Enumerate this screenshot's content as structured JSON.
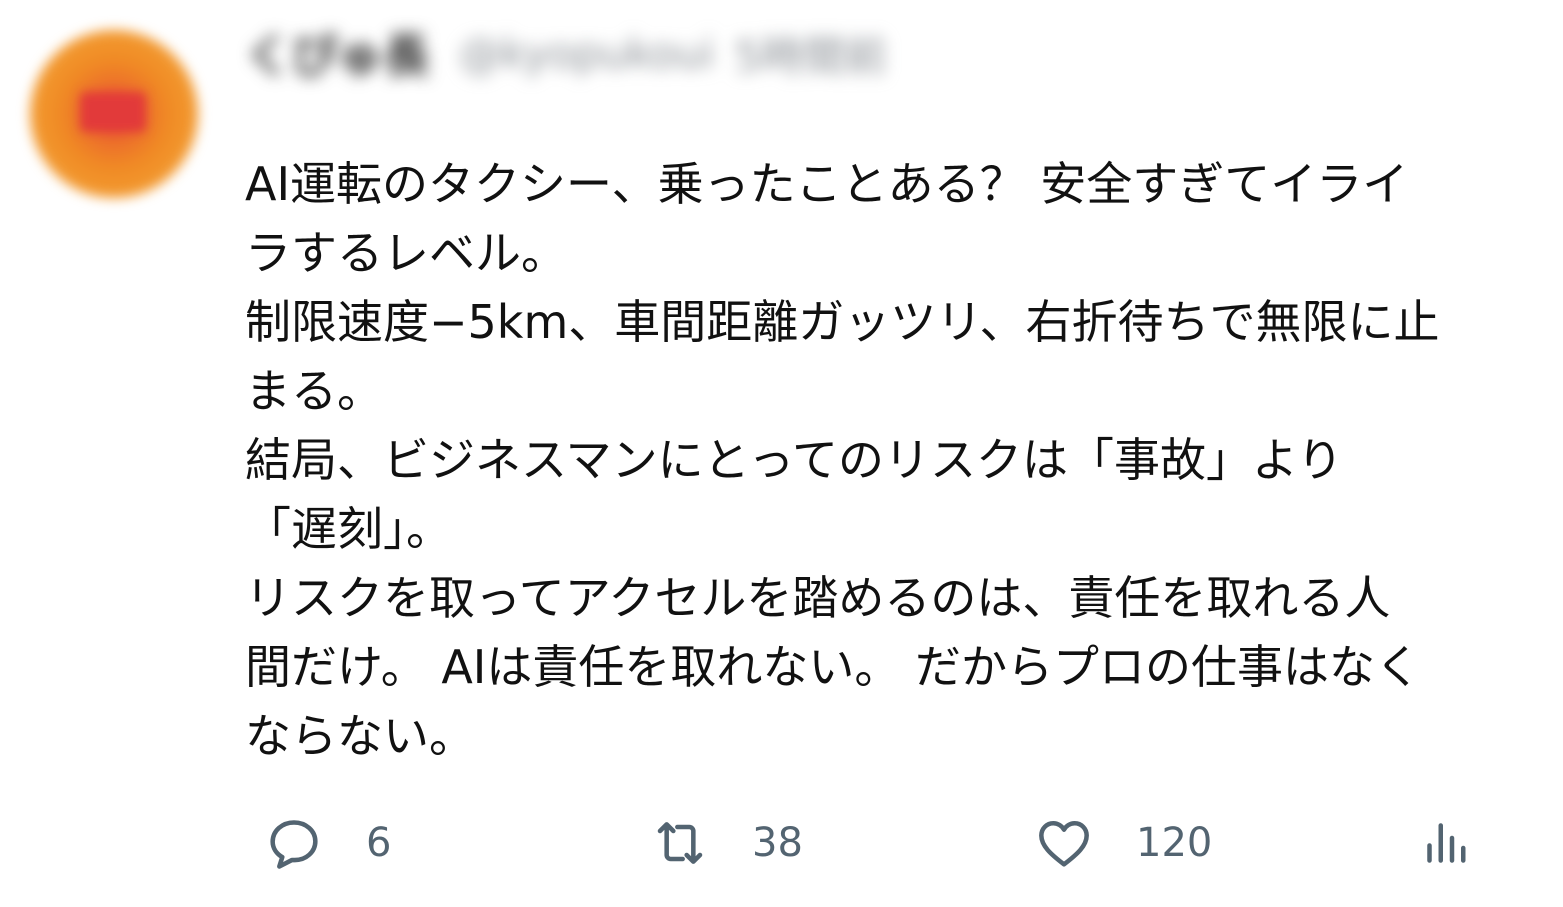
{
  "author": {
    "display_name": "くぴゅ長",
    "handle": "@kyopukoui",
    "time": "5時間前"
  },
  "tweet": {
    "lines": [
      "AI運転のタクシー、乗ったことある？ 安全すぎてイライ",
      "ラするレベル。",
      "制限速度−5km、車間距離ガッツリ、右折待ちで無限に止",
      "まる。",
      "結局、ビジネスマンにとってのリスクは「事故」より",
      "「遅刻」。",
      "リスクを取ってアクセルを踏めるのは、責任を取れる人",
      "間だけ。 AIは責任を取れない。 だからプロの仕事はなく",
      "ならない。"
    ]
  },
  "actions": {
    "reply_count": "6",
    "retweet_count": "38",
    "like_count": "120"
  },
  "icons": {
    "reply": "reply-icon",
    "retweet": "retweet-icon",
    "like": "heart-icon",
    "views": "analytics-icon"
  },
  "colors": {
    "text": "#111111",
    "muted": "#536471",
    "avatar": "#f08a24"
  }
}
